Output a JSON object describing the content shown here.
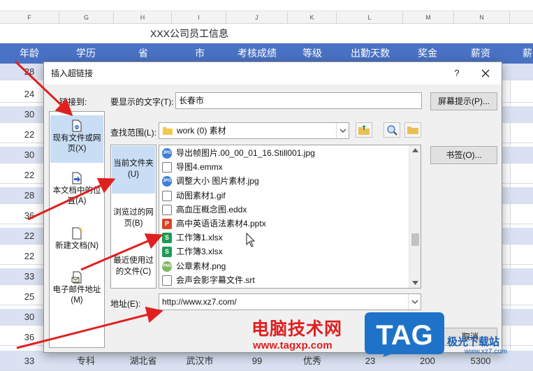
{
  "sheet": {
    "columns": [
      "F",
      "G",
      "H",
      "I",
      "J",
      "K",
      "L",
      "M",
      "N"
    ],
    "title": "XXX公司员工信息",
    "headers": [
      "年龄",
      "学历",
      "省",
      "市",
      "考核成绩",
      "等级",
      "出勤天数",
      "奖金",
      "薪资",
      "薪"
    ],
    "ages": [
      "28",
      "24",
      "30",
      "22",
      "30",
      "22",
      "28",
      "36",
      "22",
      "22",
      "33",
      "25",
      "30",
      "36"
    ],
    "last_row": [
      "33",
      "专科",
      "湖北省",
      "武汉市",
      "99",
      "优秀",
      "23",
      "200",
      "5300"
    ]
  },
  "dialog": {
    "title": "插入超链接",
    "help": "?",
    "link_to_label": "链接到:",
    "link_to_items": [
      {
        "label": "现有文件或网页(X)",
        "icon": "existing-file-icon"
      },
      {
        "label": "本文档中的位置(A)",
        "icon": "document-place-icon"
      },
      {
        "label": "新建文档(N)",
        "icon": "new-document-icon"
      },
      {
        "label": "电子邮件地址(M)",
        "icon": "email-icon"
      }
    ],
    "display_text_label": "要显示的文字(T):",
    "display_text_value": "长春市",
    "screentip_button": "屏幕提示(P)...",
    "lookin_label": "查找范围(L):",
    "lookin_value": "work (0) 素材",
    "bookmark_button": "书签(O)...",
    "nav_items": [
      "当前文件夹(U)",
      "浏览过的网页(B)",
      "最近使用过的文件(C)"
    ],
    "files": [
      {
        "name": "导出帧图片.00_00_01_16.Still001.jpg",
        "icon": "jpg-file-icon",
        "color": "#3d7fd6",
        "glyph": "JPG"
      },
      {
        "name": "导图4.emmx",
        "icon": "blank-file-icon",
        "color": "#ffffff",
        "glyph": ""
      },
      {
        "name": "调整大小 图片素材.jpg",
        "icon": "jpg-file-icon",
        "color": "#3d7fd6",
        "glyph": "JPG"
      },
      {
        "name": "动图素材1.gif",
        "icon": "gif-file-icon",
        "color": "#ffffff",
        "glyph": ""
      },
      {
        "name": "高血压概念图.eddx",
        "icon": "blank-file-icon",
        "color": "#ffffff",
        "glyph": ""
      },
      {
        "name": "高中英语语法素材4.pptx",
        "icon": "pptx-file-icon",
        "color": "#d24726",
        "glyph": "P"
      },
      {
        "name": "工作簿1.xlsx",
        "icon": "xlsx-file-icon",
        "color": "#1d9a55",
        "glyph": "S"
      },
      {
        "name": "工作簿3.xlsx",
        "icon": "xlsx-file-icon",
        "color": "#1d9a55",
        "glyph": "S"
      },
      {
        "name": "公章素材.png",
        "icon": "png-file-icon",
        "color": "#7bb661",
        "glyph": "PNG"
      },
      {
        "name": "会声会影字幕文件.srt",
        "icon": "blank-file-icon",
        "color": "#ffffff",
        "glyph": ""
      }
    ],
    "address_label": "地址(E):",
    "address_value": "http://www.xz7.com/",
    "cancel_button": "取消"
  },
  "watermark": {
    "text": "电脑技术网",
    "url": "www.tagxp.com",
    "tag": "TAG",
    "site_text": "极光下载站",
    "site_url": "www.xz7.com"
  },
  "colors": {
    "header_blue": "#4a72c4",
    "row_shade": "#d9e1f2",
    "arrow_red": "#e02020",
    "selection": "#c9def5"
  }
}
